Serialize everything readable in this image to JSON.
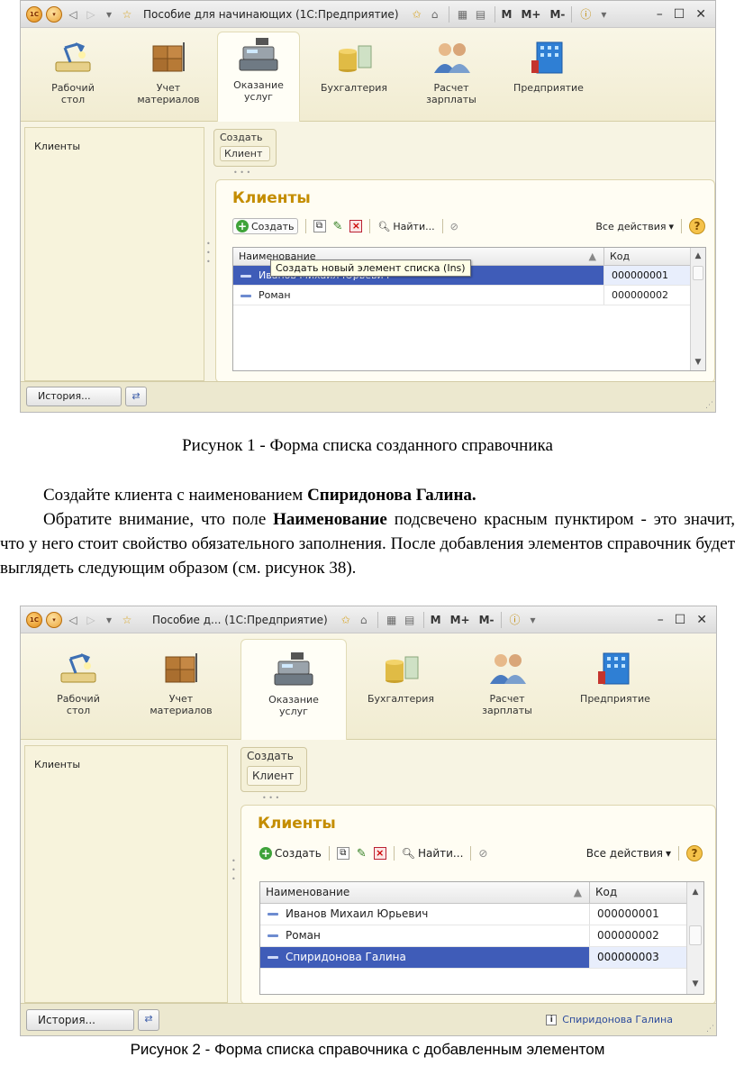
{
  "window1": {
    "title": "Пособие для начинающих  (1С:Предприятие)",
    "logo": "1С",
    "m_buttons": [
      "M",
      "M+",
      "M-"
    ],
    "sections": [
      {
        "label": "Рабочий стол",
        "icon": "desk-lamp-icon"
      },
      {
        "label": "Учет материалов",
        "icon": "boxes-cart-icon"
      },
      {
        "label": "Оказание услуг",
        "icon": "cash-register-icon"
      },
      {
        "label": "Бухгалтерия",
        "icon": "coins-icon"
      },
      {
        "label": "Расчет зарплаты",
        "icon": "people-icon"
      },
      {
        "label": "Предприятие",
        "icon": "building-icon"
      }
    ],
    "nav_item": "Клиенты",
    "create_panel": {
      "title": "Создать",
      "button": "Клиент"
    },
    "form_title": "Клиенты",
    "toolbar": {
      "create": "Создать",
      "find": "Найти...",
      "all_actions": "Все действия",
      "help": "?"
    },
    "columns": {
      "name": "Наименование",
      "code": "Код"
    },
    "rows": [
      {
        "name": "Иванов Михаил Юрьевич",
        "code": "000000001",
        "selected": true
      },
      {
        "name": "Роман",
        "code": "000000002",
        "selected": false
      }
    ],
    "tooltip": "Создать новый элемент списка (Ins)",
    "history_button": "История...",
    "status_text": ""
  },
  "caption1": "Рисунок 1 - Форма списка созданного справочника",
  "paragraph1": {
    "prefix": "Создайте клиента с наименованием ",
    "bold": "Спиридонова Галина."
  },
  "paragraph2": {
    "prefix": "Обратите внимание, что поле ",
    "bold": "Наименование",
    "suffix": " подсвечено красным пунктиром - это значит, что у него стоит свойство обязательного заполнения. После добавления элементов справочник будет выглядеть следующим образом (см. рисунок 38)."
  },
  "window2": {
    "title": "Пособие д...  (1С:Предприятие)",
    "logo": "1С",
    "m_buttons": [
      "M",
      "M+",
      "M-"
    ],
    "sections": [
      {
        "label": "Рабочий стол",
        "icon": "desk-lamp-icon"
      },
      {
        "label": "Учет материалов",
        "icon": "boxes-cart-icon"
      },
      {
        "label": "Оказание услуг",
        "icon": "cash-register-icon"
      },
      {
        "label": "Бухгалтерия",
        "icon": "coins-icon"
      },
      {
        "label": "Расчет зарплаты",
        "icon": "people-icon"
      },
      {
        "label": "Предприятие",
        "icon": "building-icon"
      }
    ],
    "nav_item": "Клиенты",
    "create_panel": {
      "title": "Создать",
      "button": "Клиент"
    },
    "form_title": "Клиенты",
    "toolbar": {
      "create": "Создать",
      "find": "Найти...",
      "all_actions": "Все действия",
      "help": "?"
    },
    "columns": {
      "name": "Наименование",
      "code": "Код"
    },
    "rows": [
      {
        "name": "Иванов Михаил Юрьевич",
        "code": "000000001",
        "selected": false
      },
      {
        "name": "Роман",
        "code": "000000002",
        "selected": false
      },
      {
        "name": "Спиридонова Галина",
        "code": "000000003",
        "selected": true
      }
    ],
    "history_button": "История...",
    "status_text": "Спиридонова Галина"
  },
  "caption2": "Рисунок 2 - Форма списка справочника с добавленным элементом"
}
